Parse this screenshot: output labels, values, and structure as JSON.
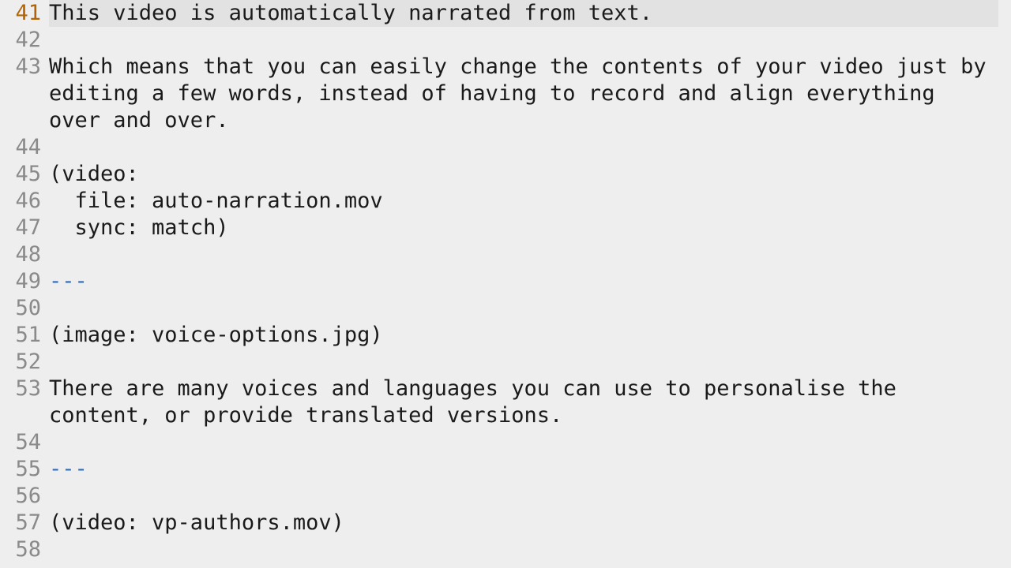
{
  "editor": {
    "current_line_index": 0,
    "lines": [
      {
        "n": 41,
        "text": "This video is automatically narrated from text.",
        "hr": false
      },
      {
        "n": 42,
        "text": "",
        "hr": false
      },
      {
        "n": 43,
        "text": "Which means that you can easily change the contents of your video just by editing a few words, instead of having to record and align everything over and over.",
        "hr": false
      },
      {
        "n": 44,
        "text": "",
        "hr": false
      },
      {
        "n": 45,
        "text": "(video:",
        "hr": false
      },
      {
        "n": 46,
        "text": "  file: auto-narration.mov",
        "hr": false
      },
      {
        "n": 47,
        "text": "  sync: match)",
        "hr": false
      },
      {
        "n": 48,
        "text": "",
        "hr": false
      },
      {
        "n": 49,
        "text": "---",
        "hr": true
      },
      {
        "n": 50,
        "text": "",
        "hr": false
      },
      {
        "n": 51,
        "text": "(image: voice-options.jpg)",
        "hr": false
      },
      {
        "n": 52,
        "text": "",
        "hr": false
      },
      {
        "n": 53,
        "text": "There are many voices and languages you can use to personalise the content, or provide translated versions.",
        "hr": false
      },
      {
        "n": 54,
        "text": "",
        "hr": false
      },
      {
        "n": 55,
        "text": "---",
        "hr": true
      },
      {
        "n": 56,
        "text": "",
        "hr": false
      },
      {
        "n": 57,
        "text": "(video: vp-authors.mov)",
        "hr": false
      },
      {
        "n": 58,
        "text": "",
        "hr": false
      }
    ]
  }
}
